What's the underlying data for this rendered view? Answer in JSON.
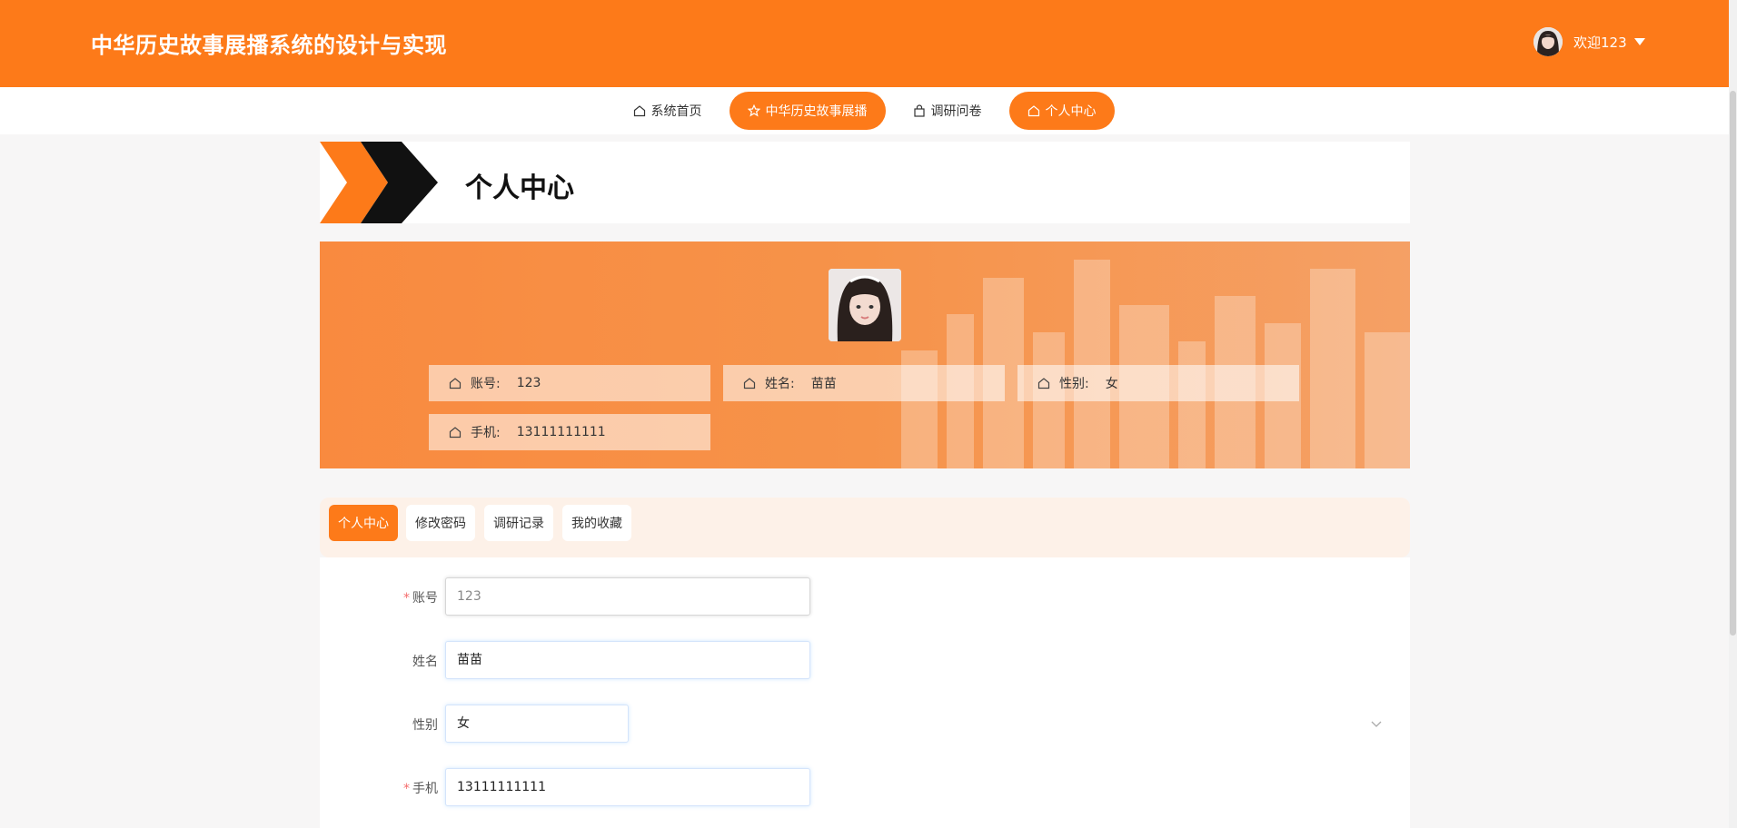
{
  "header": {
    "site_title": "中华历史故事展播系统的设计与实现",
    "welcome": "欢迎123"
  },
  "nav": [
    {
      "label": "系统首页",
      "icon": "home-icon",
      "active": false
    },
    {
      "label": "中华历史故事展播",
      "icon": "star-icon",
      "active": true
    },
    {
      "label": "调研问卷",
      "icon": "bag-icon",
      "active": false
    },
    {
      "label": "个人中心",
      "icon": "home-icon",
      "active": true
    }
  ],
  "page": {
    "title": "个人中心"
  },
  "profile": {
    "account_label": "账号:",
    "account": "123",
    "name_label": "姓名:",
    "name": "苗苗",
    "gender_label": "性别:",
    "gender": "女",
    "phone_label": "手机:",
    "phone": "13111111111"
  },
  "tabs": [
    {
      "label": "个人中心",
      "active": true
    },
    {
      "label": "修改密码",
      "active": false
    },
    {
      "label": "调研记录",
      "active": false
    },
    {
      "label": "我的收藏",
      "active": false
    }
  ],
  "form": {
    "account_label": "账号",
    "account_value": "123",
    "name_label": "姓名",
    "name_value": "苗苗",
    "gender_label": "性别",
    "gender_value": "女",
    "phone_label": "手机",
    "phone_value": "13111111111"
  },
  "colors": {
    "accent": "#fd7a19",
    "banner": "#f98a3f",
    "required": "#f56c6c"
  }
}
